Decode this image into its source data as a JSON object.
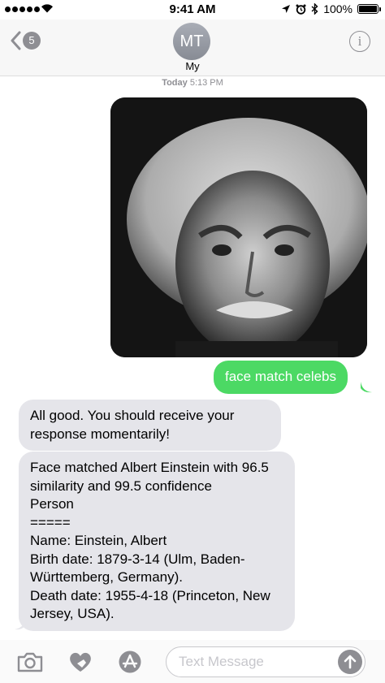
{
  "status": {
    "time": "9:41 AM",
    "battery": "100%",
    "signal_bars": 5
  },
  "header": {
    "back_count": "5",
    "avatar_initials": "MT",
    "contact_name": "My"
  },
  "conversation": {
    "timestamp_day": "Today",
    "timestamp_time": "5:13 PM",
    "sent_text": "face match celebs",
    "reply_1": "All good. You should receive your response momentarily!",
    "reply_2": "Face matched Albert Einstein with 96.5 similarity and 99.5 confidence\nPerson\n=====\nName: Einstein, Albert\nBirth date: 1879-3-14 (Ulm, Baden-Württemberg, Germany).\nDeath date: 1955-4-18 (Princeton, New Jersey, USA)."
  },
  "composer": {
    "placeholder": "Text Message",
    "camera_icon": "camera-icon",
    "digital_touch_icon": "heart-hand-icon",
    "apps_icon": "app-store-icon",
    "send_icon": "arrow-up-icon"
  },
  "colors": {
    "sent_bubble": "#4cd964",
    "received_bubble": "#e5e5ea",
    "accent": "#007aff"
  }
}
